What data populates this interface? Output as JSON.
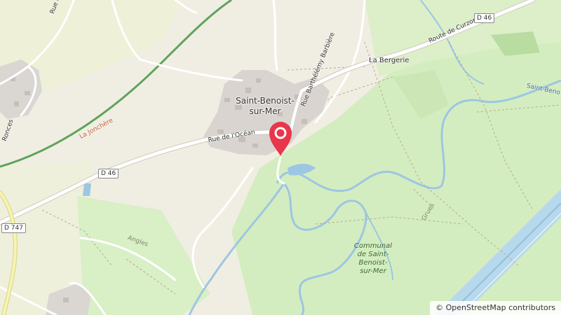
{
  "map": {
    "village": "Saint-Benoist-\nsur-Mer",
    "village_line1": "Saint-Benoist-",
    "village_line2": "sur-Mer",
    "streets": {
      "rue_du_calvaire": "Rue du Cal",
      "rue_barthelemy": "Rue Barthélémy Barbière",
      "rue_de_locean": "Rue de l'Océan",
      "route_de_curzon": "Route de Curzon",
      "jonchere": "La Jonchère",
      "ronces": "Ronces"
    },
    "localities": {
      "la_bergerie": "La Bergerie",
      "angles": "Angles",
      "grues": "Grues"
    },
    "water": {
      "saint_benoist": "Saint-Beno"
    },
    "park": {
      "line1": "Communal",
      "line2": "de Saint-",
      "line3": "Benoist-",
      "line4": "sur-Mer"
    },
    "road_refs": {
      "d46_east": "D 46",
      "d46_west": "D 46",
      "d747": "D 747"
    },
    "attribution": "© OpenStreetMap contributors",
    "colors": {
      "background": "#f2efe6",
      "grass": "#d6eec0",
      "water": "#9dc6e3",
      "road": "#ffffff",
      "marker": "#e8364a"
    }
  }
}
